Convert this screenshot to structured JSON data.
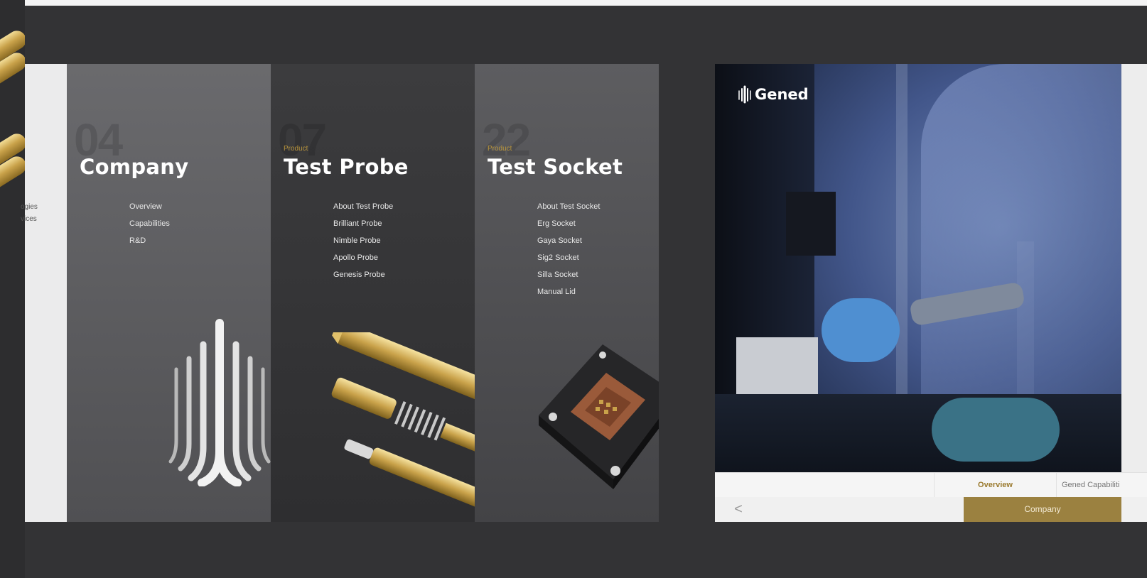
{
  "left_panel": {
    "partial_items": [
      "ogies",
      "vices"
    ]
  },
  "menu_columns": [
    {
      "number": "04",
      "kicker": "",
      "title": "Company",
      "links": [
        "Overview",
        "Capabilities",
        "R&D"
      ]
    },
    {
      "number": "07",
      "kicker": "Product",
      "title": "Test Probe",
      "links": [
        "About Test Probe",
        "Brilliant Probe",
        "Nimble Probe",
        "Apollo Probe",
        "Genesis Probe"
      ]
    },
    {
      "number": "22",
      "kicker": "Product",
      "title": "Test Socket",
      "links": [
        "About Test Socket",
        "Erg Socket",
        "Gaya Socket",
        "Sig2 Socket",
        "Silla Socket",
        "Manual Lid"
      ]
    }
  ],
  "slide": {
    "logo_text": "Gened",
    "tabs": [
      "Overview",
      "Gened Capabiliti"
    ],
    "back_symbol": "<",
    "current_section": "Company"
  },
  "colors": {
    "accent_gold": "#9b8140",
    "background": "#333335"
  }
}
